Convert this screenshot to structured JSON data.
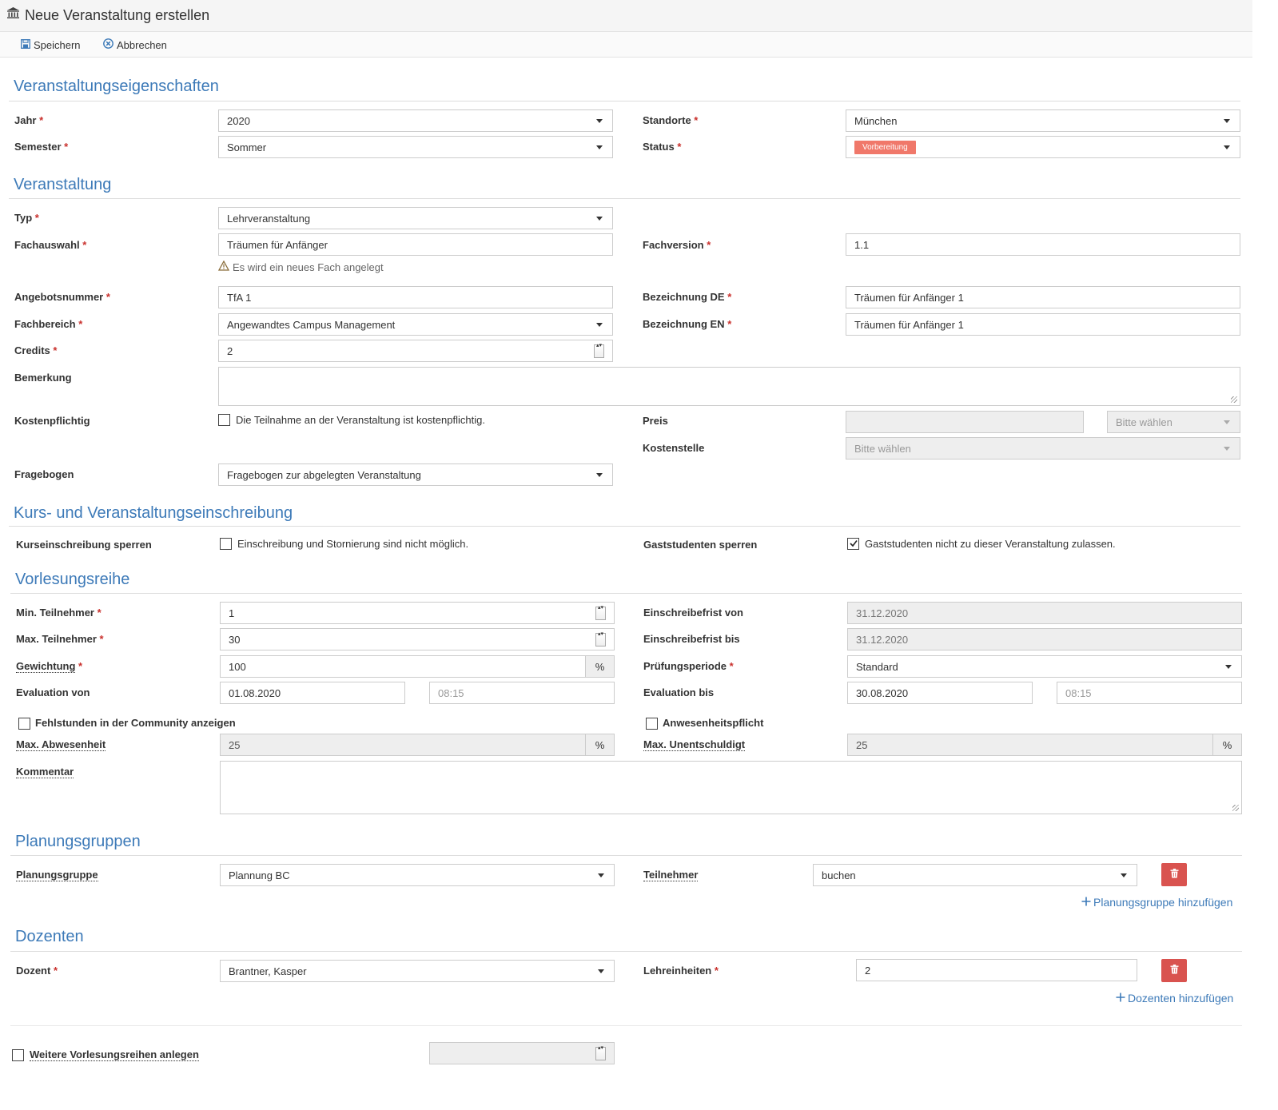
{
  "header": {
    "title": "Neue Veranstaltung erstellen",
    "icon": "institution-icon"
  },
  "toolbar": {
    "save_label": "Speichern",
    "cancel_label": "Abbrechen"
  },
  "sections": {
    "properties": "Veranstaltungseigenschaften",
    "event": "Veranstaltung",
    "enrollment": "Kurs- und Veranstaltungseinschreibung",
    "lecture_series": "Vorlesungsreihe",
    "planning_groups": "Planungsgruppen",
    "lecturers": "Dozenten"
  },
  "properties": {
    "year_label": "Jahr",
    "year_value": "2020",
    "semester_label": "Semester",
    "semester_value": "Sommer",
    "locations_label": "Standorte",
    "locations_value": "München",
    "status_label": "Status",
    "status_value": "Vorbereitung",
    "status_color": "#f0786a"
  },
  "event": {
    "type_label": "Typ",
    "type_value": "Lehrveranstaltung",
    "subject_label": "Fachauswahl",
    "subject_value": "Träumen für Anfänger",
    "subject_warning": "Es wird ein neues Fach angelegt",
    "version_label": "Fachversion",
    "version_value": "1.1",
    "offer_label": "Angebotsnummer",
    "offer_value": "TfA 1",
    "name_de_label": "Bezeichnung DE",
    "name_de_value": "Träumen für Anfänger 1",
    "department_label": "Fachbereich",
    "department_value": "Angewandtes Campus Management",
    "name_en_label": "Bezeichnung EN",
    "name_en_value": "Träumen für Anfänger 1",
    "credits_label": "Credits",
    "credits_value": "2",
    "remark_label": "Bemerkung",
    "remark_value": "",
    "paid_label": "Kostenpflichtig",
    "paid_checkbox": "Die Teilnahme an der Veranstaltung ist kostenpflichtig.",
    "paid_checked": false,
    "price_label": "Preis",
    "price_value": "",
    "price_unit_placeholder": "Bitte wählen",
    "costcenter_label": "Kostenstelle",
    "costcenter_placeholder": "Bitte wählen",
    "questionnaire_label": "Fragebogen",
    "questionnaire_value": "Fragebogen zur abgelegten Veranstaltung"
  },
  "enrollment": {
    "lock_label": "Kurseinschreibung sperren",
    "lock_checkbox": "Einschreibung und Stornierung sind nicht möglich.",
    "lock_checked": false,
    "guest_label": "Gaststudenten sperren",
    "guest_checkbox": "Gaststudenten nicht zu dieser Veranstaltung zulassen.",
    "guest_checked": true
  },
  "series": {
    "min_label": "Min. Teilnehmer",
    "min_value": "1",
    "max_label": "Max. Teilnehmer",
    "max_value": "30",
    "weight_label": "Gewichtung",
    "weight_value": "100",
    "percent": "%",
    "eval_from_label": "Evaluation von",
    "eval_from_date": "01.08.2020",
    "eval_from_time": "08:15",
    "enroll_from_label": "Einschreibefrist von",
    "enroll_from_value": "31.12.2020",
    "enroll_to_label": "Einschreibefrist bis",
    "enroll_to_value": "31.12.2020",
    "exam_label": "Prüfungsperiode",
    "exam_value": "Standard",
    "eval_to_label": "Evaluation bis",
    "eval_to_date": "30.08.2020",
    "eval_to_time": "08:15",
    "absence_show_label": "Fehlstunden in der Community anzeigen",
    "absence_show_checked": false,
    "attendance_label": "Anwesenheitspflicht",
    "attendance_checked": false,
    "max_absence_label": "Max. Abwesenheit",
    "max_absence_value": "25",
    "max_unexcused_label": "Max. Unentschuldigt",
    "max_unexcused_value": "25",
    "comment_label": "Kommentar",
    "comment_value": ""
  },
  "planning": {
    "group_label": "Planungsgruppe",
    "group_value": "Plannung BC",
    "participants_label": "Teilnehmer",
    "participants_value": "buchen",
    "add_label": "Planungsgruppe hinzufügen"
  },
  "lecturers": {
    "lecturer_label": "Dozent",
    "lecturer_value": "Brantner, Kasper",
    "units_label": "Lehreinheiten",
    "units_value": "2",
    "add_label": "Dozenten hinzufügen"
  },
  "footer": {
    "more_series_label": "Weitere Vorlesungsreihen anlegen",
    "more_series_checked": false,
    "more_series_value": ""
  }
}
